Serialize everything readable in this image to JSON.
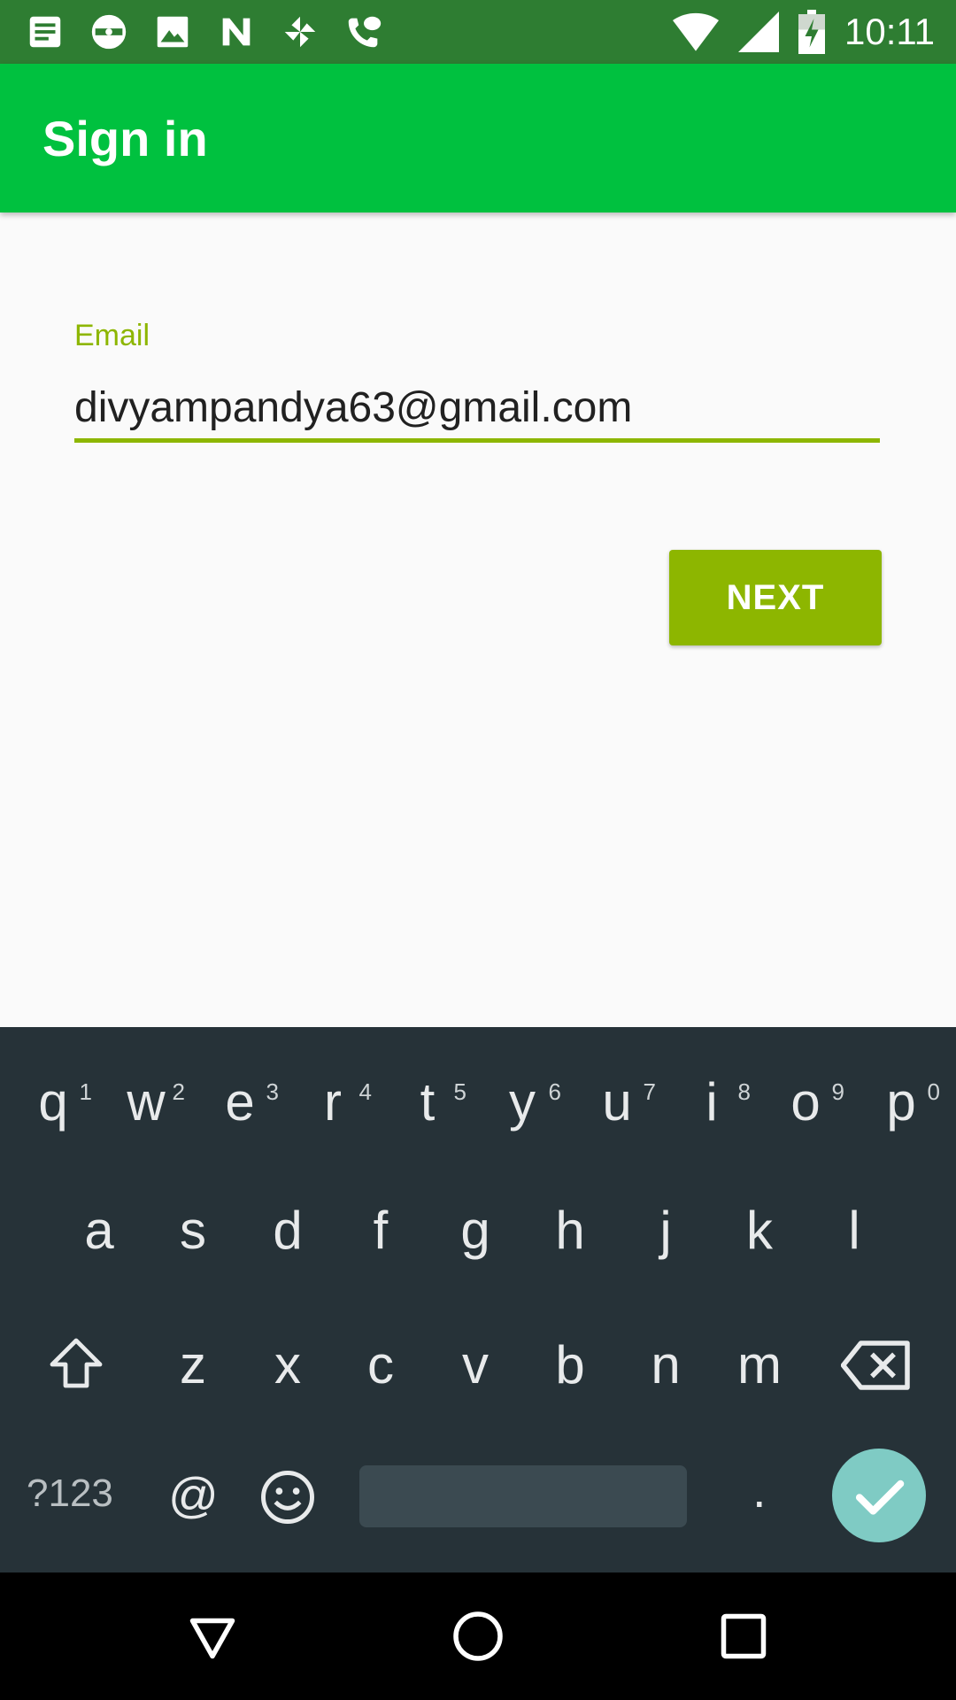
{
  "status_bar": {
    "time": "10:11",
    "notification_icons": [
      "message-icon",
      "sync-icon",
      "image-icon",
      "n-icon",
      "pinwheel-icon",
      "voicemail-icon"
    ],
    "wifi_icon": "wifi-icon",
    "signal_icon": "signal-icon",
    "battery_icon": "battery-charging-icon"
  },
  "toolbar": {
    "title": "Sign in",
    "color": "#00c13f"
  },
  "form": {
    "email_label": "Email",
    "email_value": "divyampandya63@gmail.com",
    "next_label": "NEXT",
    "accent_color": "#8db600"
  },
  "keyboard": {
    "row1": [
      {
        "key": "q",
        "hint": "1"
      },
      {
        "key": "w",
        "hint": "2"
      },
      {
        "key": "e",
        "hint": "3"
      },
      {
        "key": "r",
        "hint": "4"
      },
      {
        "key": "t",
        "hint": "5"
      },
      {
        "key": "y",
        "hint": "6"
      },
      {
        "key": "u",
        "hint": "7"
      },
      {
        "key": "i",
        "hint": "8"
      },
      {
        "key": "o",
        "hint": "9"
      },
      {
        "key": "p",
        "hint": "0"
      }
    ],
    "row2": [
      "a",
      "s",
      "d",
      "f",
      "g",
      "h",
      "j",
      "k",
      "l"
    ],
    "row3": [
      "z",
      "x",
      "c",
      "v",
      "b",
      "n",
      "m"
    ],
    "symbols_label": "?123",
    "at_label": "@",
    "period_label": ".",
    "enter_color": "#7fcbc4"
  },
  "nav_bar": {
    "buttons": [
      "back-icon",
      "home-icon",
      "recents-icon"
    ]
  }
}
